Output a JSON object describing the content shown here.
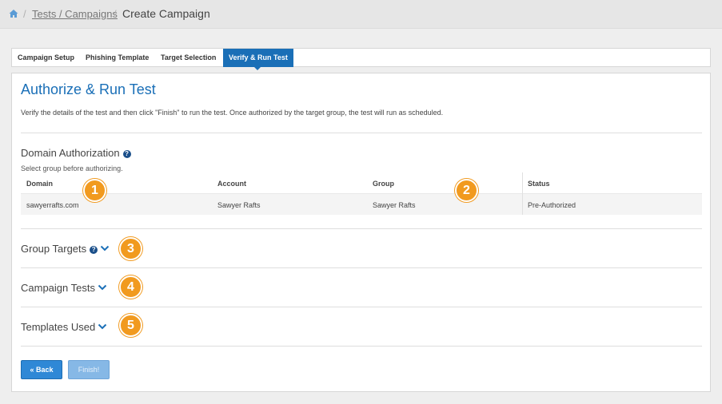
{
  "breadcrumb": {
    "home_icon": "home-icon",
    "separator": "/",
    "link": "Tests / Campaigns",
    "current": "Create Campaign"
  },
  "tabs": [
    {
      "label": "Campaign Setup",
      "active": false
    },
    {
      "label": "Phishing Template",
      "active": false
    },
    {
      "label": "Target Selection",
      "active": false
    },
    {
      "label": "Verify & Run Test",
      "active": true
    }
  ],
  "main": {
    "title": "Authorize & Run Test",
    "description": "Verify the details of the test and then click \"Finish\" to run the test. Once authorized by the target group, the test will run as scheduled.",
    "domain_authorization": {
      "title": "Domain Authorization",
      "note": "Select group before authorizing.",
      "columns": [
        "Domain",
        "Account",
        "Group",
        "Status"
      ],
      "rows": [
        [
          "sawyerrafts.com",
          "Sawyer Rafts",
          "Sawyer Rafts",
          "Pre-Authorized"
        ]
      ]
    },
    "sections": [
      {
        "title": "Group Targets",
        "has_help": true
      },
      {
        "title": "Campaign Tests",
        "has_help": false
      },
      {
        "title": "Templates Used",
        "has_help": false
      }
    ]
  },
  "badges": [
    "1",
    "2",
    "3",
    "4",
    "5"
  ],
  "buttons": {
    "back": "« Back",
    "finish": "Finish!"
  },
  "colors": {
    "accent": "#1a6fb7",
    "badge": "#f19a1f",
    "help_icon": "#1a4f8a"
  }
}
